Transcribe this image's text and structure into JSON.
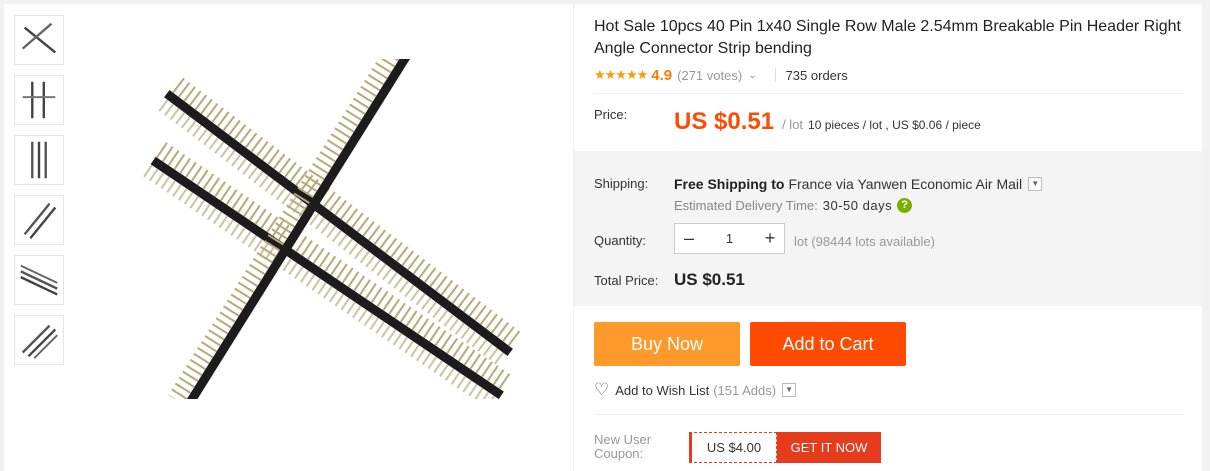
{
  "gallery": {
    "thumbnails": [
      "thumb-1",
      "thumb-2",
      "thumb-3",
      "thumb-4",
      "thumb-5",
      "thumb-6"
    ]
  },
  "product": {
    "title": "Hot Sale 10pcs 40 Pin 1x40 Single Row Male 2.54mm Breakable Pin Header Right Angle Connector Strip bending",
    "stars": "★★★★★",
    "rating": "4.9",
    "votes": "(271 votes)",
    "orders": "735 orders"
  },
  "price": {
    "label": "Price:",
    "value": "US $0.51",
    "unit": "/ lot",
    "detail": "10 pieces / lot , US $0.06 / piece"
  },
  "shipping": {
    "label": "Shipping:",
    "free": "Free Shipping to",
    "rest": "France via Yanwen Economic Air Mail",
    "delivery_label": "Estimated Delivery Time:",
    "delivery_days": "30-50  days"
  },
  "quantity": {
    "label": "Quantity:",
    "minus": "–",
    "value": "1",
    "plus": "+",
    "note": "lot (98444 lots available)"
  },
  "total": {
    "label": "Total Price:",
    "value": "US $0.51"
  },
  "actions": {
    "buy_now": "Buy Now",
    "add_to_cart": "Add to Cart"
  },
  "wishlist": {
    "label": "Add to Wish List",
    "adds": "(151 Adds)"
  },
  "coupon": {
    "label": "New User Coupon:",
    "amount": "US $4.00",
    "cta": "GET IT NOW"
  },
  "colors": {
    "price": "#ff4a00",
    "buy_now": "#ff9a2a",
    "add_to_cart": "#ff4b00",
    "coupon": "#e63c1e",
    "stars": "#ff9a00"
  }
}
